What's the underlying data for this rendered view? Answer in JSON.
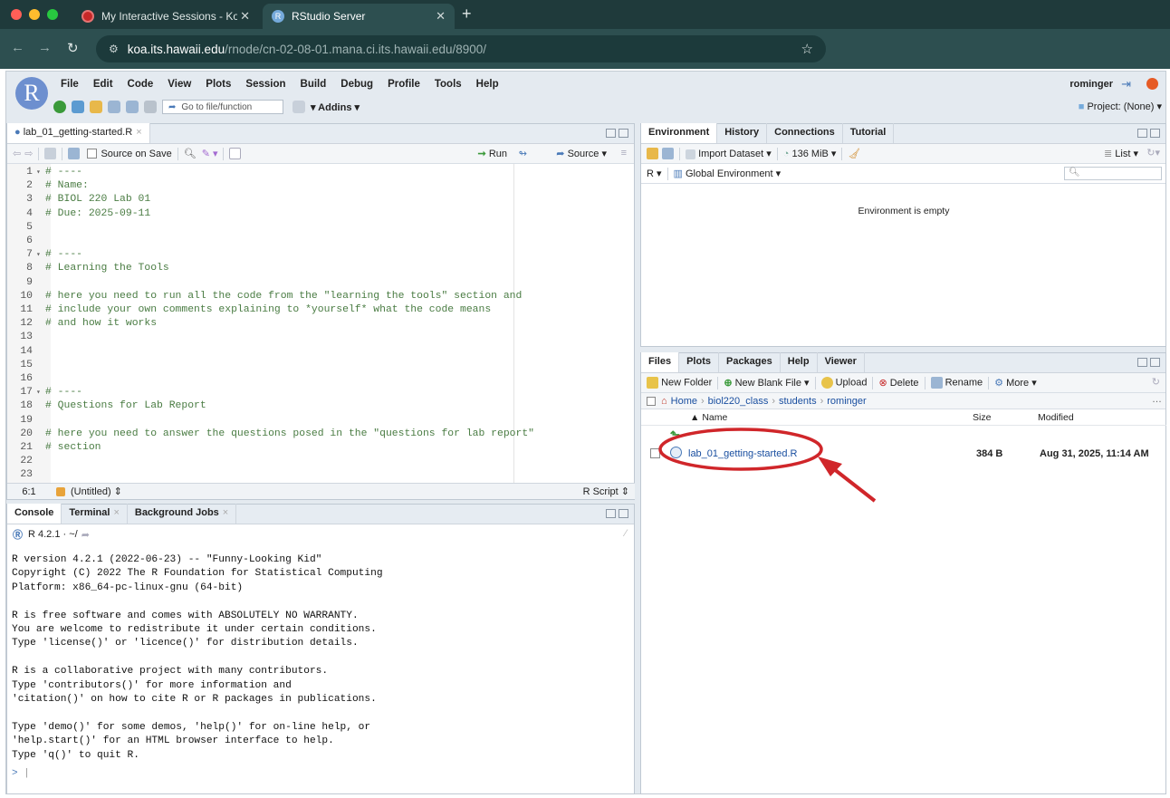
{
  "browser": {
    "tabs": [
      {
        "title": "My Interactive Sessions - Koa"
      },
      {
        "title": "RStudio Server"
      }
    ],
    "url_host": "koa.its.hawaii.edu",
    "url_path": "/rnode/cn-02-08-01.mana.ci.its.hawaii.edu/8900/"
  },
  "menubar": {
    "items": [
      "File",
      "Edit",
      "Code",
      "View",
      "Plots",
      "Session",
      "Build",
      "Debug",
      "Profile",
      "Tools",
      "Help"
    ],
    "user": "rominger"
  },
  "toolbar": {
    "goto_placeholder": "Go to file/function",
    "addins": "Addins",
    "project": "Project: (None)"
  },
  "editor": {
    "tab_label": "lab_01_getting-started.R",
    "source_on_save": "Source on Save",
    "run": "Run",
    "source": "Source",
    "lines": [
      {
        "n": "1",
        "fold": true,
        "text": "# ----"
      },
      {
        "n": "2",
        "fold": false,
        "text": "# Name:"
      },
      {
        "n": "3",
        "fold": false,
        "text": "# BIOL 220 Lab 01"
      },
      {
        "n": "4",
        "fold": false,
        "text": "# Due: 2025-09-11"
      },
      {
        "n": "5",
        "fold": false,
        "text": ""
      },
      {
        "n": "6",
        "fold": false,
        "text": ""
      },
      {
        "n": "7",
        "fold": true,
        "text": "# ----"
      },
      {
        "n": "8",
        "fold": false,
        "text": "# Learning the Tools"
      },
      {
        "n": "9",
        "fold": false,
        "text": ""
      },
      {
        "n": "10",
        "fold": false,
        "text": "# here you need to run all the code from the \"learning the tools\" section and"
      },
      {
        "n": "11",
        "fold": false,
        "text": "# include your own comments explaining to *yourself* what the code means"
      },
      {
        "n": "12",
        "fold": false,
        "text": "# and how it works"
      },
      {
        "n": "13",
        "fold": false,
        "text": ""
      },
      {
        "n": "14",
        "fold": false,
        "text": ""
      },
      {
        "n": "15",
        "fold": false,
        "text": ""
      },
      {
        "n": "16",
        "fold": false,
        "text": ""
      },
      {
        "n": "17",
        "fold": true,
        "text": "# ----"
      },
      {
        "n": "18",
        "fold": false,
        "text": "# Questions for Lab Report"
      },
      {
        "n": "19",
        "fold": false,
        "text": ""
      },
      {
        "n": "20",
        "fold": false,
        "text": "# here you need to answer the questions posed in the \"questions for lab report\""
      },
      {
        "n": "21",
        "fold": false,
        "text": "# section"
      },
      {
        "n": "22",
        "fold": false,
        "text": ""
      },
      {
        "n": "23",
        "fold": false,
        "text": ""
      }
    ],
    "status_pos": "6:1",
    "status_scope": "(Untitled)",
    "status_type": "R Script"
  },
  "console": {
    "tabs": [
      "Console",
      "Terminal",
      "Background Jobs"
    ],
    "version_path": "R 4.2.1 · ~/",
    "output": "R version 4.2.1 (2022-06-23) -- \"Funny-Looking Kid\"\nCopyright (C) 2022 The R Foundation for Statistical Computing\nPlatform: x86_64-pc-linux-gnu (64-bit)\n\nR is free software and comes with ABSOLUTELY NO WARRANTY.\nYou are welcome to redistribute it under certain conditions.\nType 'license()' or 'licence()' for distribution details.\n\nR is a collaborative project with many contributors.\nType 'contributors()' for more information and\n'citation()' on how to cite R or R packages in publications.\n\nType 'demo()' for some demos, 'help()' for on-line help, or\n'help.start()' for an HTML browser interface to help.\nType 'q()' to quit R.",
    "prompt": ">"
  },
  "environment": {
    "tabs": [
      "Environment",
      "History",
      "Connections",
      "Tutorial"
    ],
    "import_dataset": "Import Dataset",
    "memory": "136 MiB",
    "list": "List",
    "lang": "R",
    "scope": "Global Environment",
    "empty_msg": "Environment is empty"
  },
  "files": {
    "tabs": [
      "Files",
      "Plots",
      "Packages",
      "Help",
      "Viewer"
    ],
    "new_folder": "New Folder",
    "new_blank_file": "New Blank File",
    "upload": "Upload",
    "delete": "Delete",
    "rename": "Rename",
    "more": "More",
    "breadcrumb": [
      "Home",
      "biol220_class",
      "students",
      "rominger"
    ],
    "col_name": "Name",
    "col_size": "Size",
    "col_modified": "Modified",
    "rows": [
      {
        "name": "lab_01_getting-started.R",
        "size": "384 B",
        "modified": "Aug 31, 2025, 11:14 AM"
      }
    ]
  },
  "colors": {
    "highlight": "#d0262a",
    "accent": "#75aadb"
  }
}
